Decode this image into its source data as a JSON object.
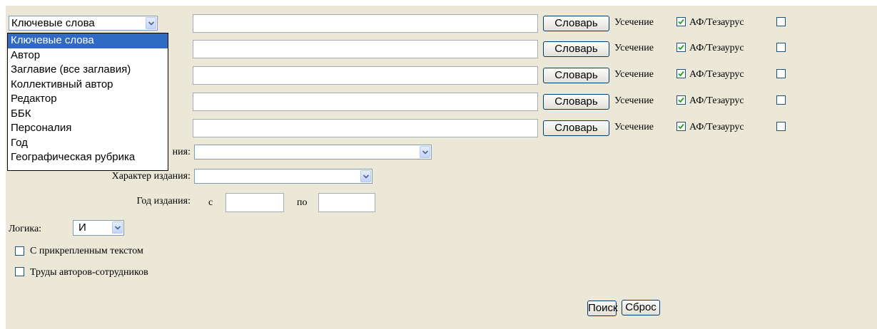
{
  "field_select": {
    "selected": "Ключевые слова",
    "options": [
      "Ключевые слова",
      "Автор",
      "Заглавие (все заглавия)",
      "Коллективный автор",
      "Редактор",
      "ББК",
      "Персоналия",
      "Год",
      "Географическая рубрика"
    ]
  },
  "search_rows": [
    {
      "dictionary_label": "Словарь",
      "truncation_label": "Усечение",
      "truncation_checked": true,
      "thesaurus_label": "АФ/Тезаурус",
      "thesaurus_checked": false
    },
    {
      "dictionary_label": "Словарь",
      "truncation_label": "Усечение",
      "truncation_checked": true,
      "thesaurus_label": "АФ/Тезаурус",
      "thesaurus_checked": false
    },
    {
      "dictionary_label": "Словарь",
      "truncation_label": "Усечение",
      "truncation_checked": true,
      "thesaurus_label": "АФ/Тезаурус",
      "thesaurus_checked": false
    },
    {
      "dictionary_label": "Словарь",
      "truncation_label": "Усечение",
      "truncation_checked": true,
      "thesaurus_label": "АФ/Тезаурус",
      "thesaurus_checked": false
    },
    {
      "dictionary_label": "Словарь",
      "truncation_label": "Усечение",
      "truncation_checked": true,
      "thesaurus_label": "АФ/Тезаурус",
      "thesaurus_checked": false
    }
  ],
  "filters": {
    "publication_type_label_partial": "ния:",
    "publication_character_label": "Характер издания:",
    "year_label": "Год издания:",
    "year_from_label": "с",
    "year_to_label": "по"
  },
  "logic": {
    "label": "Логика:",
    "value": "И"
  },
  "options": {
    "attached_text_label": "С прикрепленным текстом",
    "staff_works_label": "Труды авторов-сотрудников"
  },
  "actions": {
    "search_label": "Поиск",
    "reset_label": "Сброс"
  },
  "colors": {
    "panel_bg": "#ebe8d8",
    "selection_bg": "#316ac5",
    "checkmark": "#21a121"
  }
}
